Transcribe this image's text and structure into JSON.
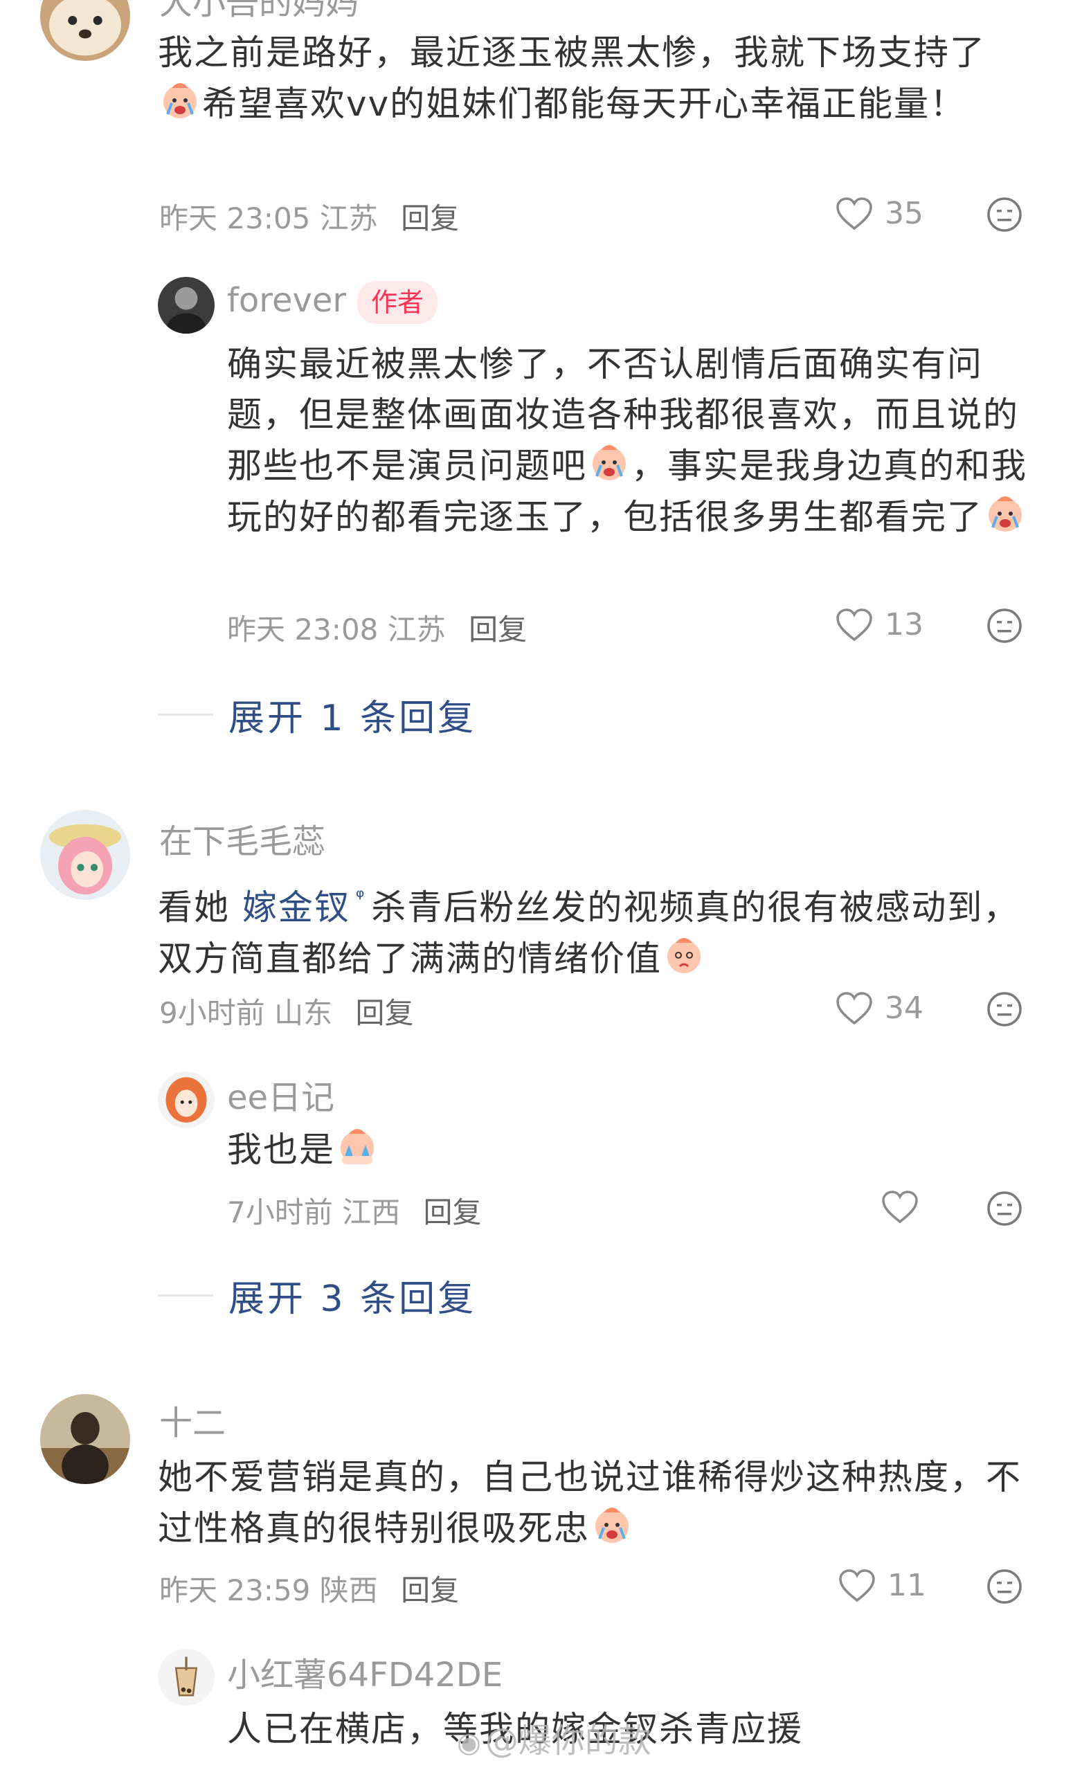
{
  "comments": [
    {
      "username": "大小吾的妈妈",
      "text_parts": [
        "我之前是路好，最近逐玉被黑太惨，我就下场支持了",
        "希望喜欢vv的姐妹们都能每天开心幸福正能量！"
      ],
      "emoji": "crying-emoji",
      "time": "昨天 23:05",
      "location": "江苏",
      "reply_label": "回复",
      "likes": "35",
      "reply": {
        "username": "forever",
        "badge": "作者",
        "text_parts": [
          "确实最近被黑太惨了，不否认剧情后面确实有问题，但是整体画面妆造各种我都很喜欢，而且说的那些也不是演员问题吧",
          "，事实是我身边真的和我玩的好的都看完逐玉了，包括很多男生都看完了",
          ""
        ],
        "time": "昨天 23:08",
        "location": "江苏",
        "reply_label": "回复",
        "likes": "13"
      },
      "expand": "展开 1 条回复"
    },
    {
      "username": "在下毛毛蕊",
      "text_prefix": "看她 ",
      "link": "嫁金钗",
      "text_parts": [
        "杀青后粉丝发的视频真的很有被感动到，双方简直都给了满满的情绪价值",
        ""
      ],
      "time": "9小时前",
      "location": "山东",
      "reply_label": "回复",
      "likes": "34",
      "reply": {
        "username": "ee日记",
        "text_parts": [
          "我也是",
          ""
        ],
        "time": "7小时前",
        "location": "江西",
        "reply_label": "回复",
        "likes": ""
      },
      "expand": "展开 3 条回复"
    },
    {
      "username": "十二",
      "text_parts": [
        "她不爱营销是真的，自己也说过谁稀得炒这种热度，不过性格真的很特别很吸死忠",
        ""
      ],
      "time": "昨天 23:59",
      "location": "陕西",
      "reply_label": "回复",
      "likes": "11",
      "reply": {
        "username": "小红薯64FD42DE",
        "text_parts": [
          "人已在横店，等我的嫁金钗杀青应援"
        ]
      }
    }
  ],
  "watermark": "@爆你的款",
  "colors": {
    "text": "#333333",
    "meta": "#9a9a9a",
    "link": "#2f4d86",
    "badge_bg": "#fde8ea",
    "badge_text": "#ff3355"
  }
}
